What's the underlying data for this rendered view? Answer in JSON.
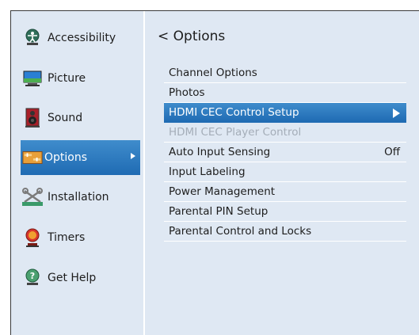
{
  "sidebar": {
    "items": [
      {
        "label": "Accessibility",
        "icon": "accessibility-icon"
      },
      {
        "label": "Picture",
        "icon": "picture-icon"
      },
      {
        "label": "Sound",
        "icon": "sound-icon"
      },
      {
        "label": "Options",
        "icon": "options-icon",
        "selected": true
      },
      {
        "label": "Installation",
        "icon": "installation-icon"
      },
      {
        "label": "Timers",
        "icon": "timers-icon"
      },
      {
        "label": "Get Help",
        "icon": "get-help-icon"
      }
    ]
  },
  "main": {
    "back_glyph": "<",
    "title": "Options",
    "items": [
      {
        "label": "Channel Options"
      },
      {
        "label": "Photos"
      },
      {
        "label": "HDMI CEC Control Setup",
        "selected": true
      },
      {
        "label": "HDMI CEC Player Control",
        "disabled": true
      },
      {
        "label": "Auto Input Sensing",
        "value": "Off"
      },
      {
        "label": "Input Labeling"
      },
      {
        "label": "Power Management"
      },
      {
        "label": "Parental PIN Setup"
      },
      {
        "label": "Parental Control and Locks"
      }
    ]
  },
  "colors": {
    "background": "#dfe8f3",
    "highlight": "#2a78bd",
    "disabled_text": "#a4adb8"
  }
}
